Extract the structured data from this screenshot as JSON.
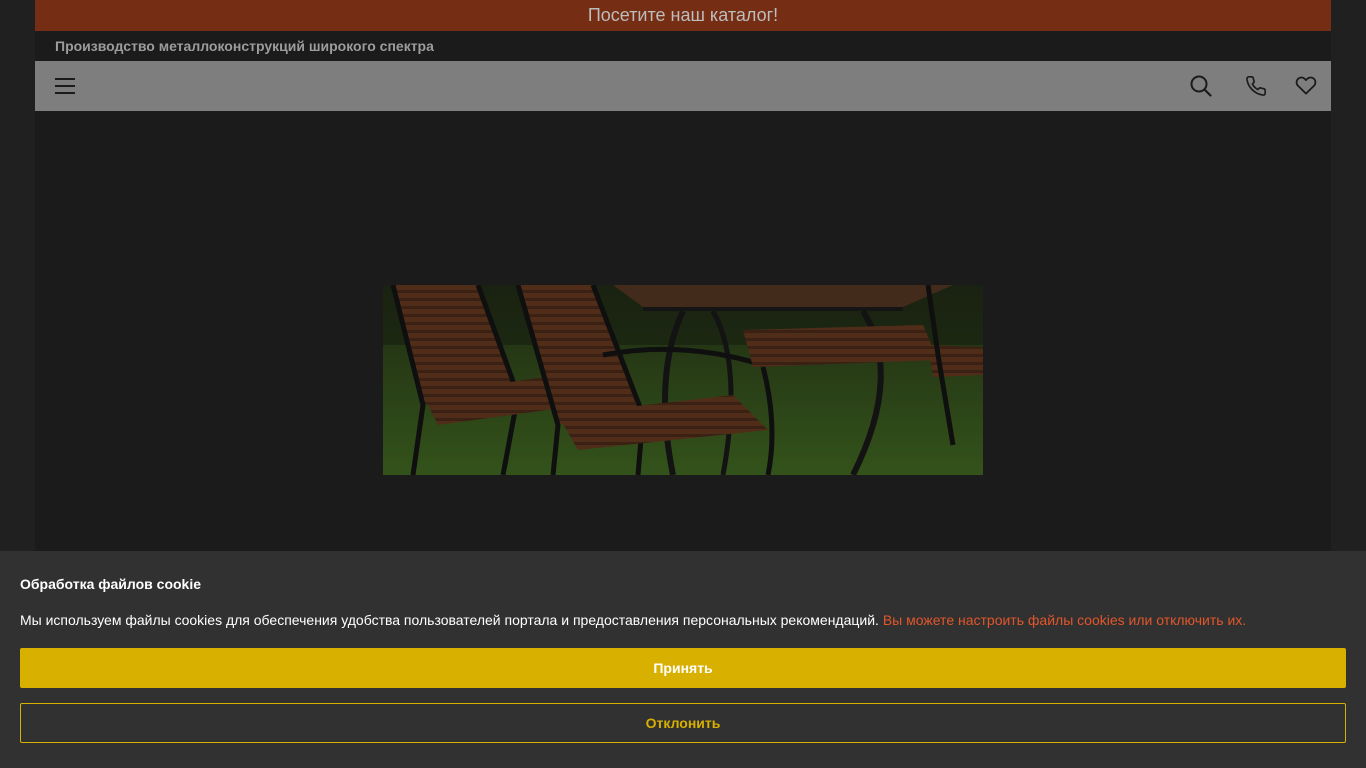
{
  "header": {
    "promo": "Посетите наш каталог!",
    "tagline": "Производство металлоконструкций широкого спектра"
  },
  "nav": {
    "menu_icon": "hamburger-menu-icon",
    "search_icon": "search-icon",
    "phone_icon": "phone-icon",
    "favorites_icon": "heart-icon"
  },
  "hero": {
    "image": "outdoor-garden-furniture-photo"
  },
  "cookie": {
    "title": "Обработка файлов cookie",
    "text": "Мы используем файлы cookies для обеспечения удобства пользователей портала и предоставления персональных рекомендаций.",
    "link": "Вы можете настроить файлы cookies или отключить их.",
    "accept": "Принять",
    "decline": "Отклонить"
  },
  "colors": {
    "promo_bg": "#752d14",
    "nav_bg": "#7e7e7e",
    "accent": "#d8b000",
    "link": "#e2562a"
  }
}
